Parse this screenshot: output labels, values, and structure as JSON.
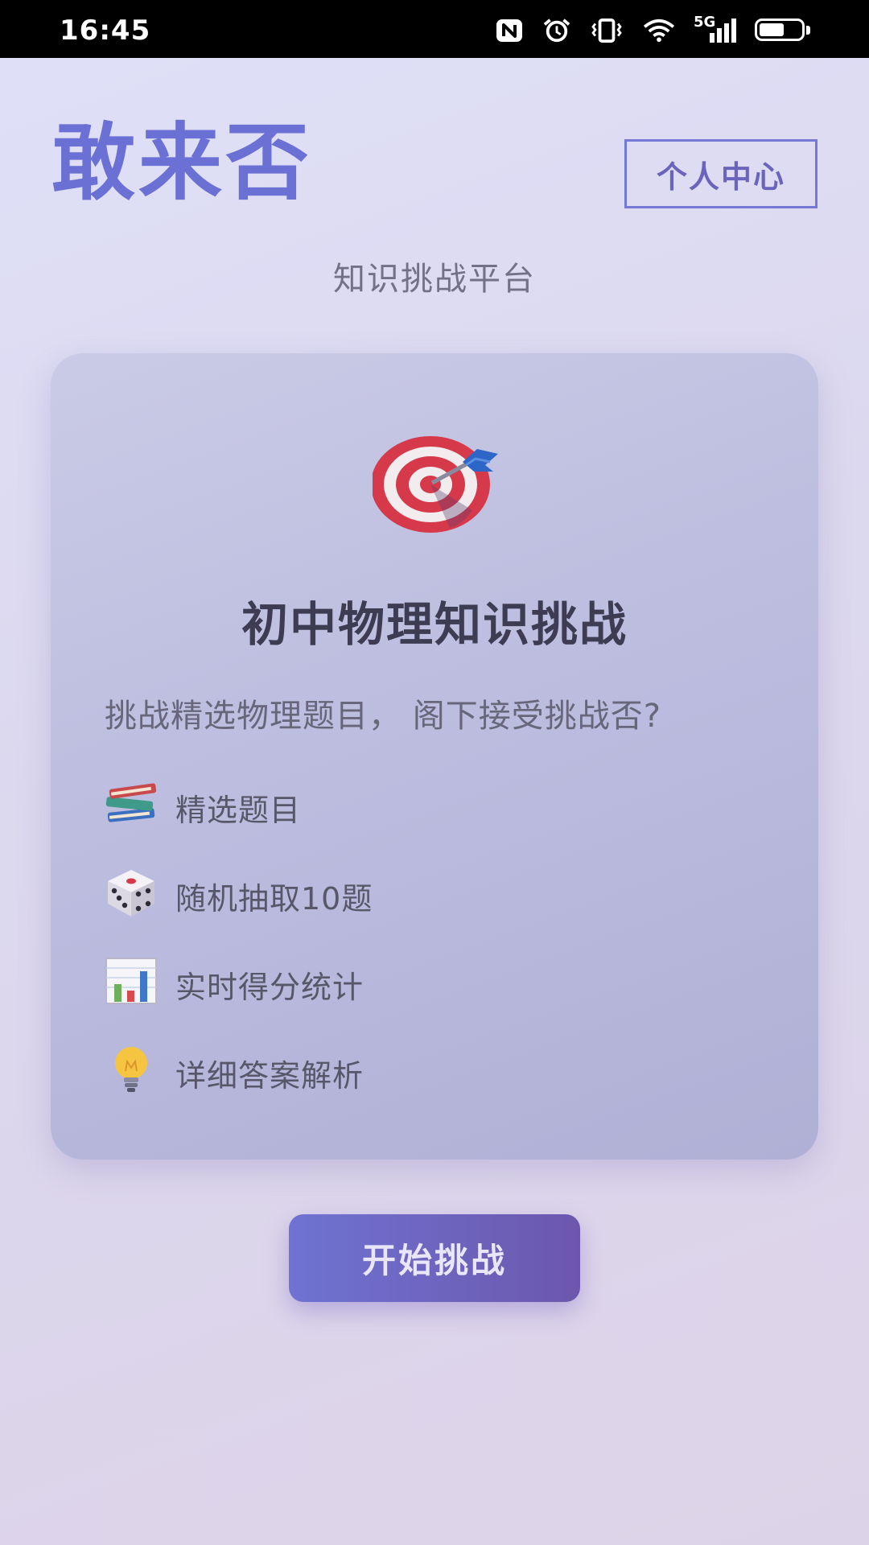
{
  "status_bar": {
    "time": "16:45",
    "network_label": "5G",
    "icons": [
      "nfc-icon",
      "alarm-icon",
      "vibrate-icon",
      "wifi-icon",
      "signal-icon",
      "battery-icon"
    ]
  },
  "header": {
    "app_title": "敢来否",
    "subtitle": "知识挑战平台",
    "profile_button": "个人中心"
  },
  "card": {
    "icon": "target-icon",
    "title": "初中物理知识挑战",
    "description": "挑战精选物理题目， 阁下接受挑战否?",
    "features": [
      {
        "icon": "books-icon",
        "label": "精选题目"
      },
      {
        "icon": "dice-icon",
        "label": "随机抽取10题"
      },
      {
        "icon": "bar-chart-icon",
        "label": "实时得分统计"
      },
      {
        "icon": "lightbulb-icon",
        "label": "详细答案解析"
      }
    ]
  },
  "start_button": "开始挑战",
  "colors": {
    "accent": "#6b70d4",
    "button_gradient_start": "#6f73d2",
    "button_gradient_end": "#6c57ad"
  }
}
